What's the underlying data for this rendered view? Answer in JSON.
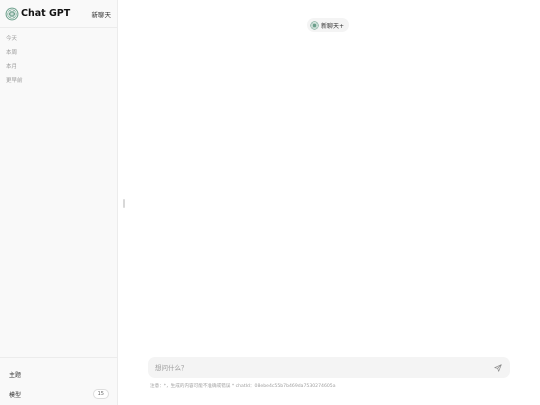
{
  "sidebar": {
    "brand": "Chat GPT",
    "new_chat_label": "新聊天",
    "groups": [
      "今天",
      "本周",
      "本月",
      "更早前"
    ],
    "footer": {
      "theme_label": "主题",
      "model_label": "模型",
      "model_count": "15"
    }
  },
  "header": {
    "new_chat_pill": "新聊天+"
  },
  "composer": {
    "placeholder": "想问什么？",
    "value": ""
  },
  "notice": "注意：*，生成的内容可能不准确或错误 * chatId：08ebe4c55b7b469da7530274605a",
  "colors": {
    "sidebar_bg": "#f9f9f9",
    "composer_bg": "#f4f4f4",
    "logo": "#6b9e8a"
  },
  "icons": [
    "openai-logo-icon",
    "send-icon"
  ]
}
